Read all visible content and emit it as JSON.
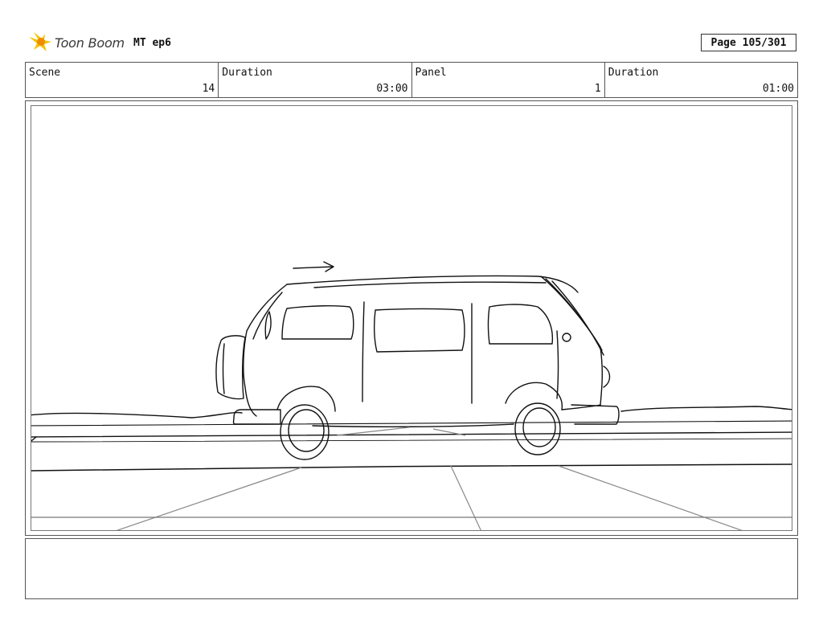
{
  "header": {
    "logo_text": "Toon Boom",
    "logo_icon": "toon-boom-star-icon",
    "project": "MT ep6",
    "page": "Page 105/301"
  },
  "info": {
    "scene_label": "Scene",
    "scene_value": "14",
    "scene_duration_label": "Duration",
    "scene_duration_value": "03:00",
    "panel_label": "Panel",
    "panel_value": "1",
    "panel_duration_label": "Duration",
    "panel_duration_value": "01:00"
  },
  "notes": {
    "text": ""
  }
}
